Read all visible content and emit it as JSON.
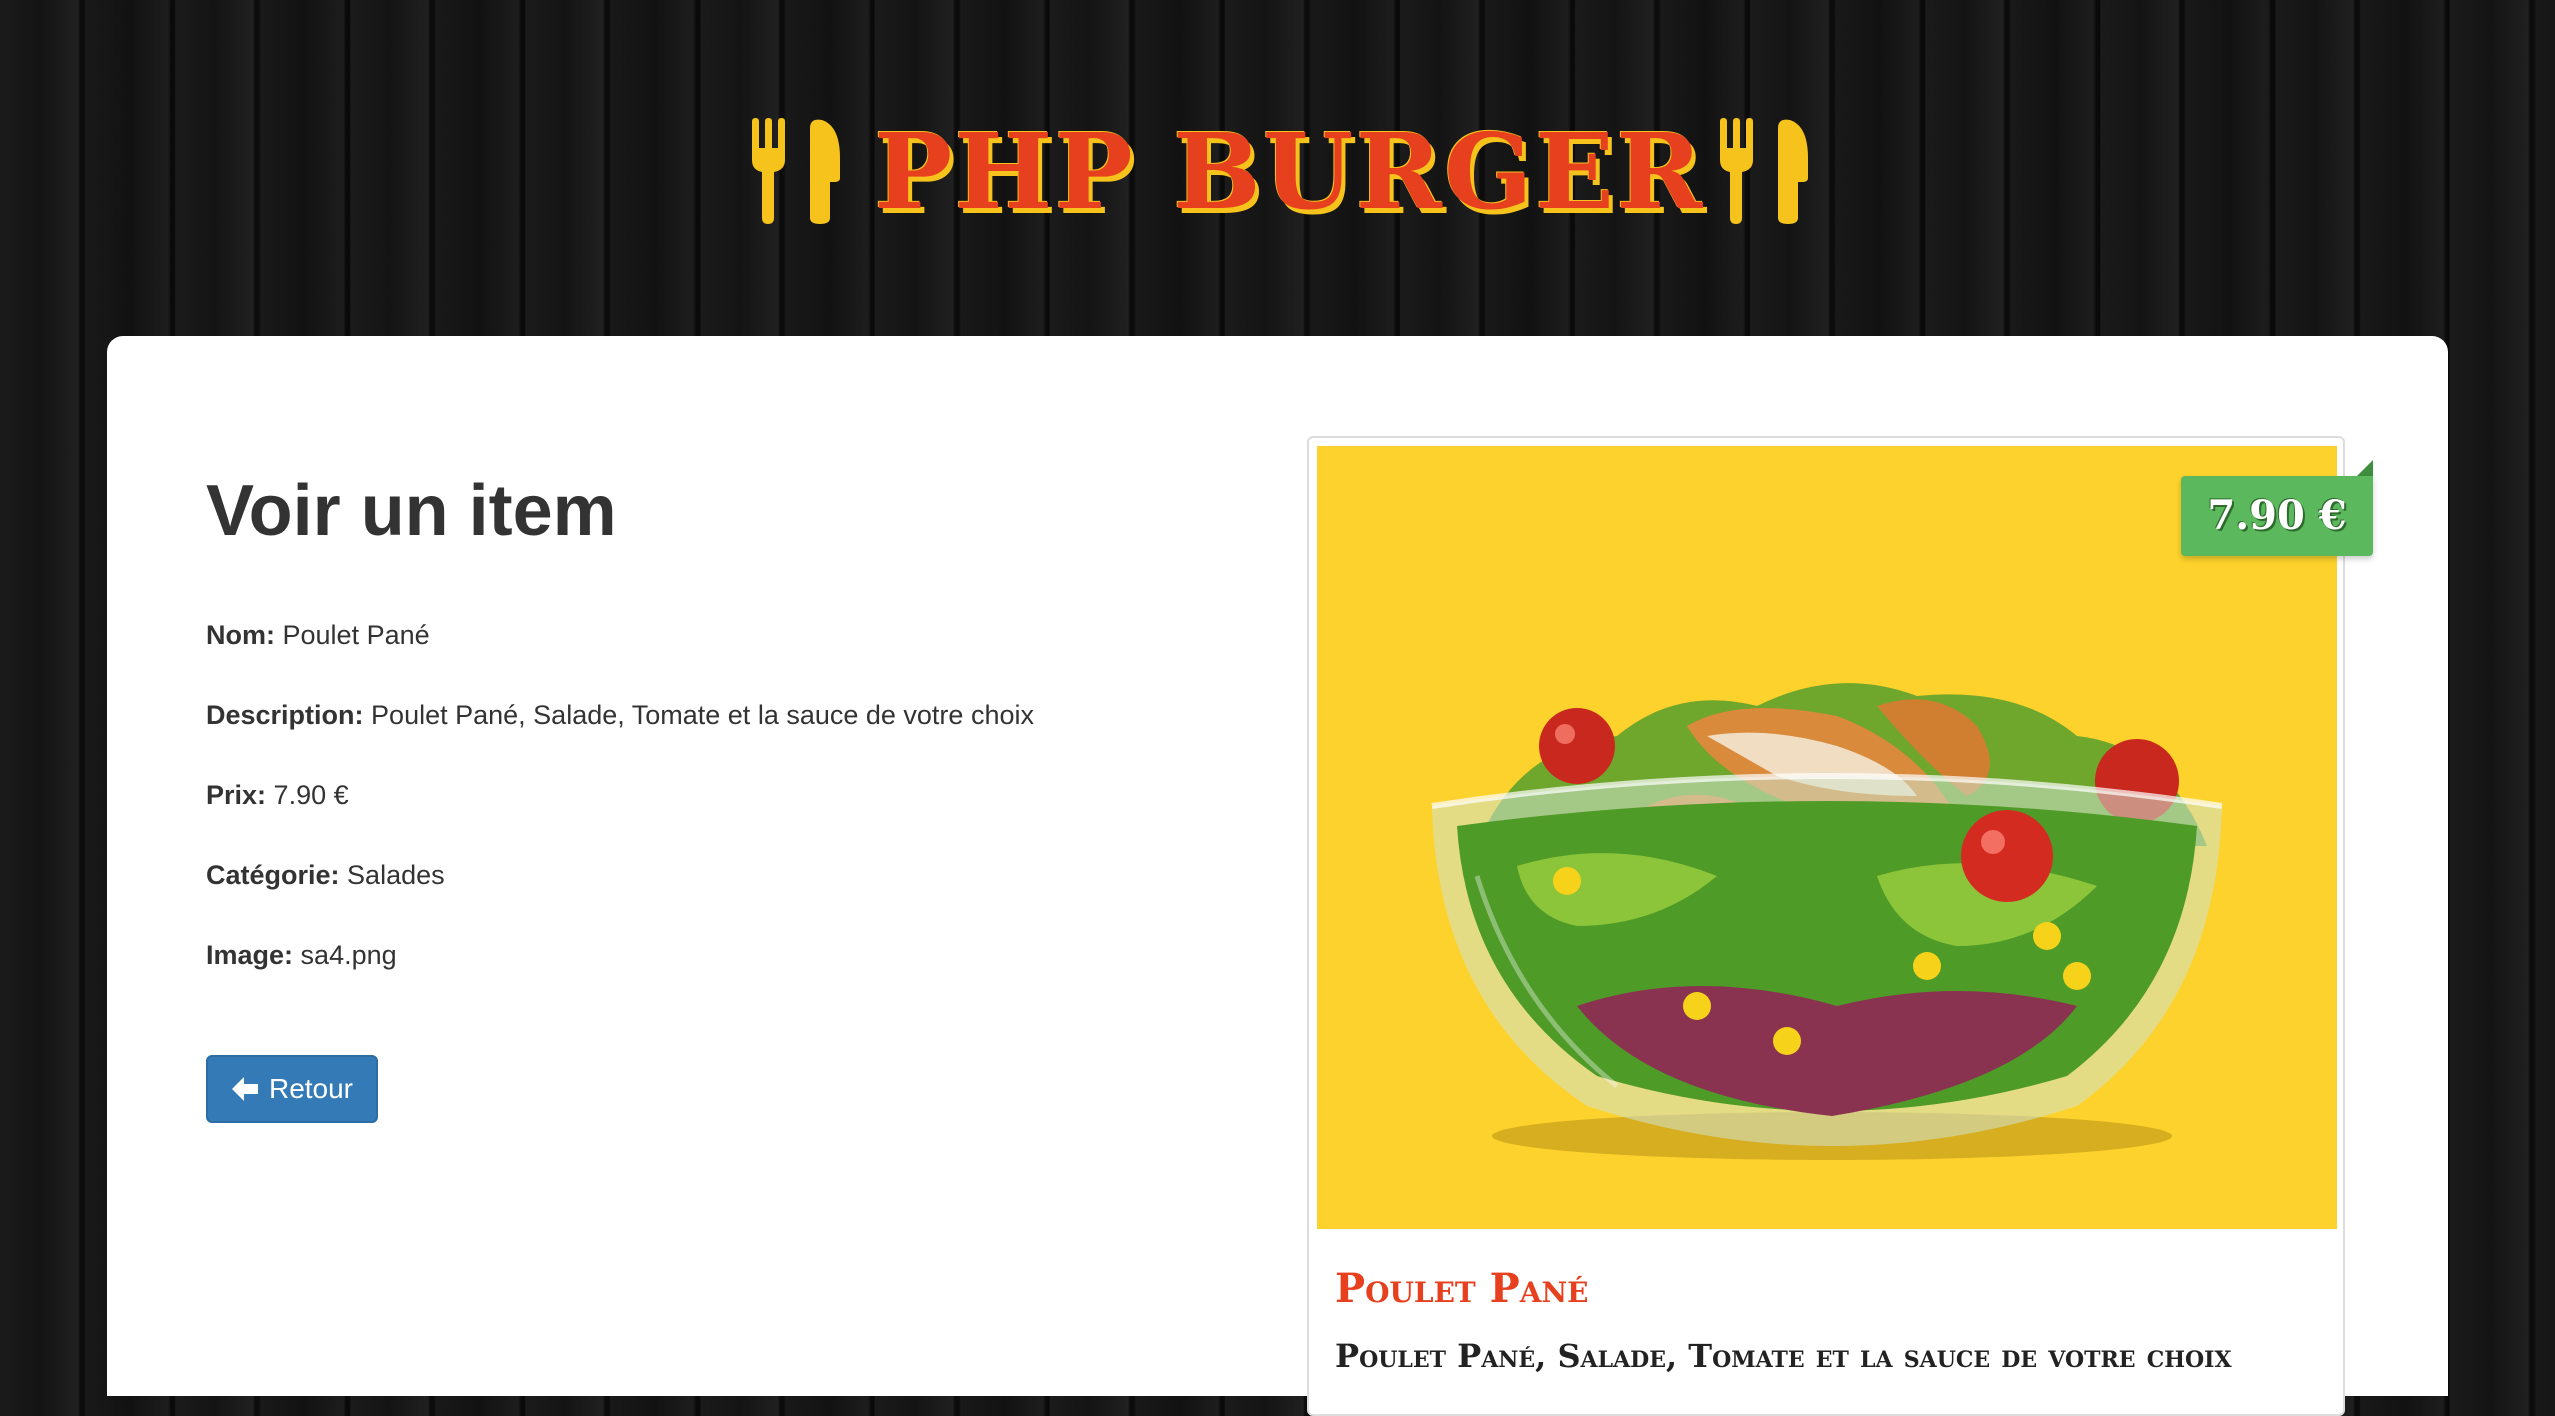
{
  "header": {
    "brand": "PHP BURGER",
    "left_icon": "fork-knife-icon",
    "right_icon": "fork-knife-icon",
    "brand_color": "#e6401e",
    "accent_color": "#f6c21c"
  },
  "page": {
    "title": "Voir un item"
  },
  "item": {
    "fields": [
      {
        "label": "Nom:",
        "value": "Poulet Pané"
      },
      {
        "label": "Description:",
        "value": "Poulet Pané, Salade, Tomate et la sauce de votre choix"
      },
      {
        "label": "Prix:",
        "value": "7.90 €"
      },
      {
        "label": "Catégorie:",
        "value": "Salades"
      },
      {
        "label": "Image:",
        "value": "sa4.png"
      }
    ]
  },
  "actions": {
    "back_label": "Retour",
    "back_icon": "arrow-left-icon",
    "back_color": "#337ab7"
  },
  "preview": {
    "price": "7.90 €",
    "price_color": "#5cb85c",
    "image_background": "#fdd22c",
    "image_alt": "salad-bowl-image",
    "name": "Poulet Pané",
    "description": "Poulet Pané, Salade, Tomate et la sauce de votre choix"
  }
}
